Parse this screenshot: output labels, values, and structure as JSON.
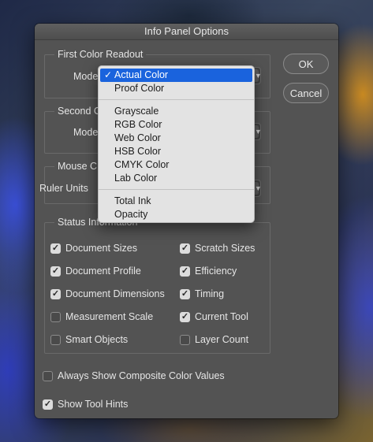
{
  "dialog": {
    "title": "Info Panel Options"
  },
  "buttons": {
    "ok": "OK",
    "cancel": "Cancel"
  },
  "first_color": {
    "legend": "First Color Readout",
    "mode_label": "Mode:"
  },
  "second_color": {
    "legend": "Second C",
    "mode_label": "Mode:"
  },
  "mouse": {
    "legend": "Mouse C",
    "units_label": "Ruler Units"
  },
  "status": {
    "legend": "Status Information",
    "left": [
      {
        "label": "Document Sizes",
        "checked": true
      },
      {
        "label": "Document Profile",
        "checked": true
      },
      {
        "label": "Document Dimensions",
        "checked": true
      },
      {
        "label": "Measurement Scale",
        "checked": false
      },
      {
        "label": "Smart Objects",
        "checked": false
      }
    ],
    "right": [
      {
        "label": "Scratch Sizes",
        "checked": true
      },
      {
        "label": "Efficiency",
        "checked": true
      },
      {
        "label": "Timing",
        "checked": true
      },
      {
        "label": "Current Tool",
        "checked": true
      },
      {
        "label": "Layer Count",
        "checked": false
      }
    ]
  },
  "options": {
    "composite": {
      "label": "Always Show Composite Color Values",
      "checked": false
    },
    "tool_hints": {
      "label": "Show Tool Hints",
      "checked": true
    }
  },
  "menu": {
    "check_glyph": "✓",
    "group1": [
      "Actual Color",
      "Proof Color"
    ],
    "group2": [
      "Grayscale",
      "RGB Color",
      "Web Color",
      "HSB Color",
      "CMYK Color",
      "Lab Color"
    ],
    "group3": [
      "Total Ink",
      "Opacity"
    ],
    "selected": "Actual Color"
  },
  "icons": {
    "dropdown": "chevron-updown-icon",
    "checkmark": "checkmark-icon"
  },
  "colors": {
    "dialog_bg": "#535353",
    "menu_bg": "#e3e3e3",
    "highlight": "#1a63dd"
  }
}
